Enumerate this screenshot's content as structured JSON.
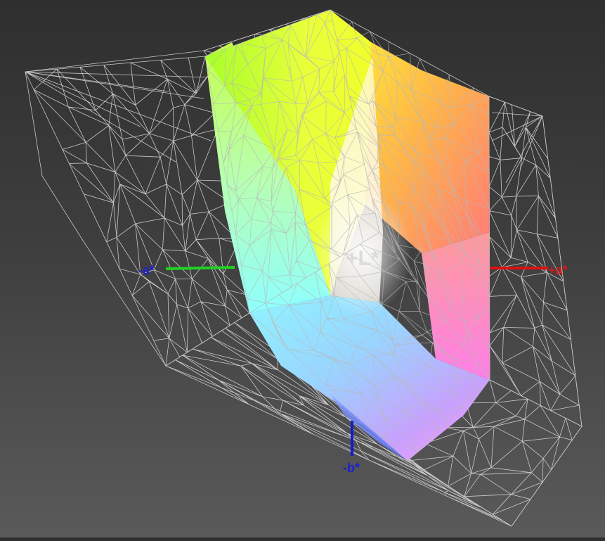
{
  "axes": {
    "plus_l": {
      "label": "+L*",
      "color": "#d8d8d8"
    },
    "minus_a": {
      "label": "-a*",
      "color": "#1f1fd0"
    },
    "plus_a": {
      "label": "+a*",
      "color": "#d81818"
    },
    "minus_b": {
      "label": "-b*",
      "color": "#1f1fd0"
    }
  },
  "colors": {
    "background_top": "#2f2f2f",
    "background_bottom": "#5a5a5a",
    "wireframe": "#c8c8c8",
    "green_axis": "#22d022",
    "red_axis": "#e01010",
    "blue_axis": "#1a1ac8"
  }
}
